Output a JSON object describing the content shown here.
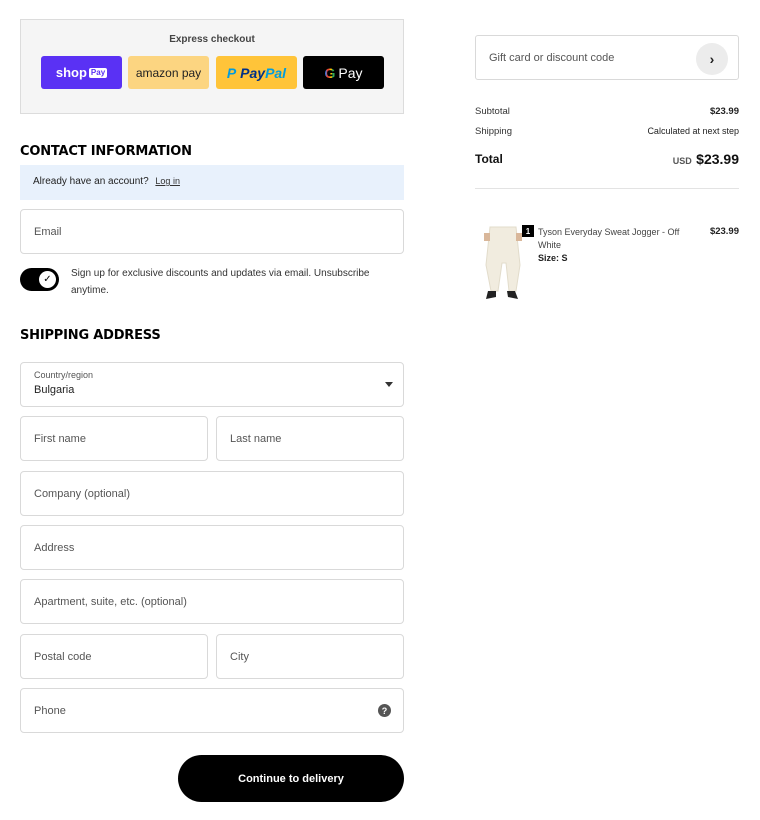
{
  "express": {
    "title": "Express checkout",
    "shop_pay": {
      "word": "shop",
      "tag": "Pay"
    },
    "amazon_pay": "amazon pay",
    "paypal": {
      "p1": "Pay",
      "p2": "Pal"
    },
    "gpay": {
      "g": "G",
      "label": "Pay"
    }
  },
  "contact": {
    "heading": "CONTACT INFORMATION",
    "account_prompt": "Already have an account?",
    "login_link": "Log in",
    "email_placeholder": "Email",
    "marketing_opt_in": "Sign up for exclusive discounts and updates via email. Unsubscribe anytime.",
    "marketing_checked": true
  },
  "shipping": {
    "heading": "SHIPPING ADDRESS",
    "country_label": "Country/region",
    "country_value": "Bulgaria",
    "first_name": "First name",
    "last_name": "Last name",
    "company": "Company (optional)",
    "address": "Address",
    "apartment": "Apartment, suite, etc. (optional)",
    "postal_code": "Postal code",
    "city": "City",
    "phone": "Phone",
    "help_glyph": "?"
  },
  "actions": {
    "continue_label": "Continue to delivery"
  },
  "summary": {
    "discount_placeholder": "Gift card or discount code",
    "arrow_glyph": "›",
    "subtotal_label": "Subtotal",
    "subtotal_value": "$23.99",
    "shipping_label": "Shipping",
    "shipping_value": "Calculated at next step",
    "total_label": "Total",
    "total_currency": "USD",
    "total_value": "$23.99"
  },
  "cart": {
    "items": [
      {
        "quantity": "1",
        "name": "Tyson Everyday Sweat Jogger - Off White",
        "size": "Size: S",
        "price": "$23.99"
      }
    ]
  },
  "colors": {
    "shop_pay": "#5a31f4",
    "amazon_pay": "#fcd581",
    "paypal": "#ffc439",
    "primary_button": "#000000",
    "account_bar": "#e8f1fc"
  }
}
